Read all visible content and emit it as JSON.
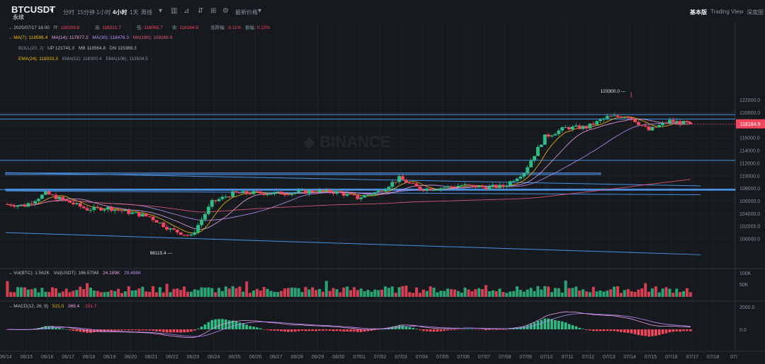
{
  "toolbar": {
    "symbol": "BTCUSDT",
    "contract": "永续",
    "timeframes": [
      "分时",
      "15分钟",
      "1小时",
      "4小时",
      "1天",
      "周线"
    ],
    "active_timeframe": "4小时",
    "latest_price_label": "最新价格",
    "right_tabs": [
      "基本版",
      "Trading View",
      "深度图"
    ],
    "active_right_tab": "基本版"
  },
  "colors": {
    "up": "#2ebd85",
    "down": "#f6465d",
    "ma7": "#f0b90b",
    "ma14": "#e8a0e8",
    "ma30": "#b88bf5",
    "ma180": "#e05a7a",
    "trend": "#4a90e2"
  },
  "info": {
    "ohlc": {
      "date": "2025/07/17 16:00",
      "open_label": "开:",
      "open": "118293.8",
      "high_label": "高:",
      "high": "118321.7",
      "low_label": "低:",
      "low": "118065.7",
      "close_label": "收:",
      "close": "118184.9",
      "chg_label": "涨跌幅:",
      "chg": "-0.11%",
      "amp_label": "振幅:",
      "amp": "0.22%"
    },
    "ma": {
      "ma7": "MA(7): 118596.4",
      "ma14": "MA(14): 117877.2",
      "ma30": "MA(30): 118476.3",
      "ma180": "MA(180): 109266.9"
    },
    "boll": {
      "label": "BOLL(20, 2)",
      "up": "UP  121741.3",
      "mb": "MB  118564.8",
      "dn": "DN  115388.3"
    },
    "ema": {
      "e24": "EMA(24): 118033.3",
      "e52": "EMA(52): 116300.4",
      "e106": "EMA(106): 113504.5"
    },
    "vol": {
      "btc": "Vol(BTC): 1.562K",
      "usdt": "Vol(USDT): 186.575M",
      "v1": "24.189K",
      "v2": "29.486K"
    },
    "macd": {
      "label": "MACD(12, 26, 9)",
      "v1": "521.0",
      "v2": "369.4",
      "v3": "-151.7"
    }
  },
  "chart_data": {
    "type": "candlestick",
    "interval": "4h",
    "y_ticks": [
      100000,
      102000,
      104000,
      106000,
      108000,
      110000,
      112000,
      114000,
      116000,
      118000,
      120000,
      122000
    ],
    "y_tick_labels": [
      "100000.0",
      "102000.0",
      "104000.0",
      "106000.0",
      "108000.0",
      "110000.0",
      "112000.0",
      "114000.0",
      "116000.0",
      "118000.0",
      "120000.0",
      "122000.0"
    ],
    "x_labels": [
      "06/14",
      "06/15",
      "06/16",
      "06/17",
      "06/18",
      "06/19",
      "06/20",
      "06/21",
      "06/22",
      "06/23",
      "06/24",
      "06/25",
      "06/26",
      "06/27",
      "06/28",
      "06/29",
      "06/30",
      "07/01",
      "07/02",
      "07/03",
      "07/04",
      "07/05",
      "07/06",
      "07/07",
      "07/08",
      "07/09",
      "07/10",
      "07/11",
      "07/12",
      "07/13",
      "07/14",
      "07/15",
      "07/16",
      "07/17",
      "07/18",
      "07/"
    ],
    "anchors": [
      [
        "06/14",
        105500
      ],
      [
        "06/15",
        105300
      ],
      [
        "06/16",
        107200
      ],
      [
        "06/17",
        106000
      ],
      [
        "06/18",
        104700
      ],
      [
        "06/19",
        104900
      ],
      [
        "06/20",
        104200
      ],
      [
        "06/21",
        103500
      ],
      [
        "06/22",
        101500
      ],
      [
        "06/23",
        100400
      ],
      [
        "06/24",
        105800
      ],
      [
        "06/25",
        107200
      ],
      [
        "06/26",
        107300
      ],
      [
        "06/27",
        107200
      ],
      [
        "06/28",
        107350
      ],
      [
        "06/29",
        107600
      ],
      [
        "06/30",
        107400
      ],
      [
        "07/01",
        106500
      ],
      [
        "07/02",
        107500
      ],
      [
        "07/03",
        109600
      ],
      [
        "07/04",
        107900
      ],
      [
        "07/05",
        108100
      ],
      [
        "07/06",
        108500
      ],
      [
        "07/07",
        108200
      ],
      [
        "07/08",
        108300
      ],
      [
        "07/09",
        110600
      ],
      [
        "07/10",
        116200
      ],
      [
        "07/11",
        117600
      ],
      [
        "07/12",
        117700
      ],
      [
        "07/13",
        119300
      ],
      [
        "07/14",
        119500
      ],
      [
        "07/15",
        117200
      ],
      [
        "07/16",
        118700
      ],
      [
        "07/17",
        118184.9
      ]
    ],
    "high_annotation": {
      "label": "123300.0",
      "value": 123300,
      "date": "07/14"
    },
    "low_annotation": {
      "label": "98115.4",
      "value": 98115.4,
      "date": "06/22"
    },
    "last_price": "118184.9",
    "horizontal_levels": [
      119700,
      119000,
      112450,
      107800
    ],
    "zones": [
      [
        110200,
        110450
      ],
      [
        107700,
        107900
      ]
    ],
    "trendlines": [
      [
        [
          "06/14",
          110500
        ],
        [
          "07/17",
          108400
        ]
      ],
      [
        [
          "06/14",
          101000
        ],
        [
          "07/17",
          97500
        ]
      ],
      [
        [
          "06/14",
          107600
        ],
        [
          "07/17",
          107000
        ]
      ]
    ],
    "volume_ticks": [
      "100K",
      "50K"
    ],
    "macd_ticks": [
      "2000.0",
      "0.0"
    ]
  }
}
